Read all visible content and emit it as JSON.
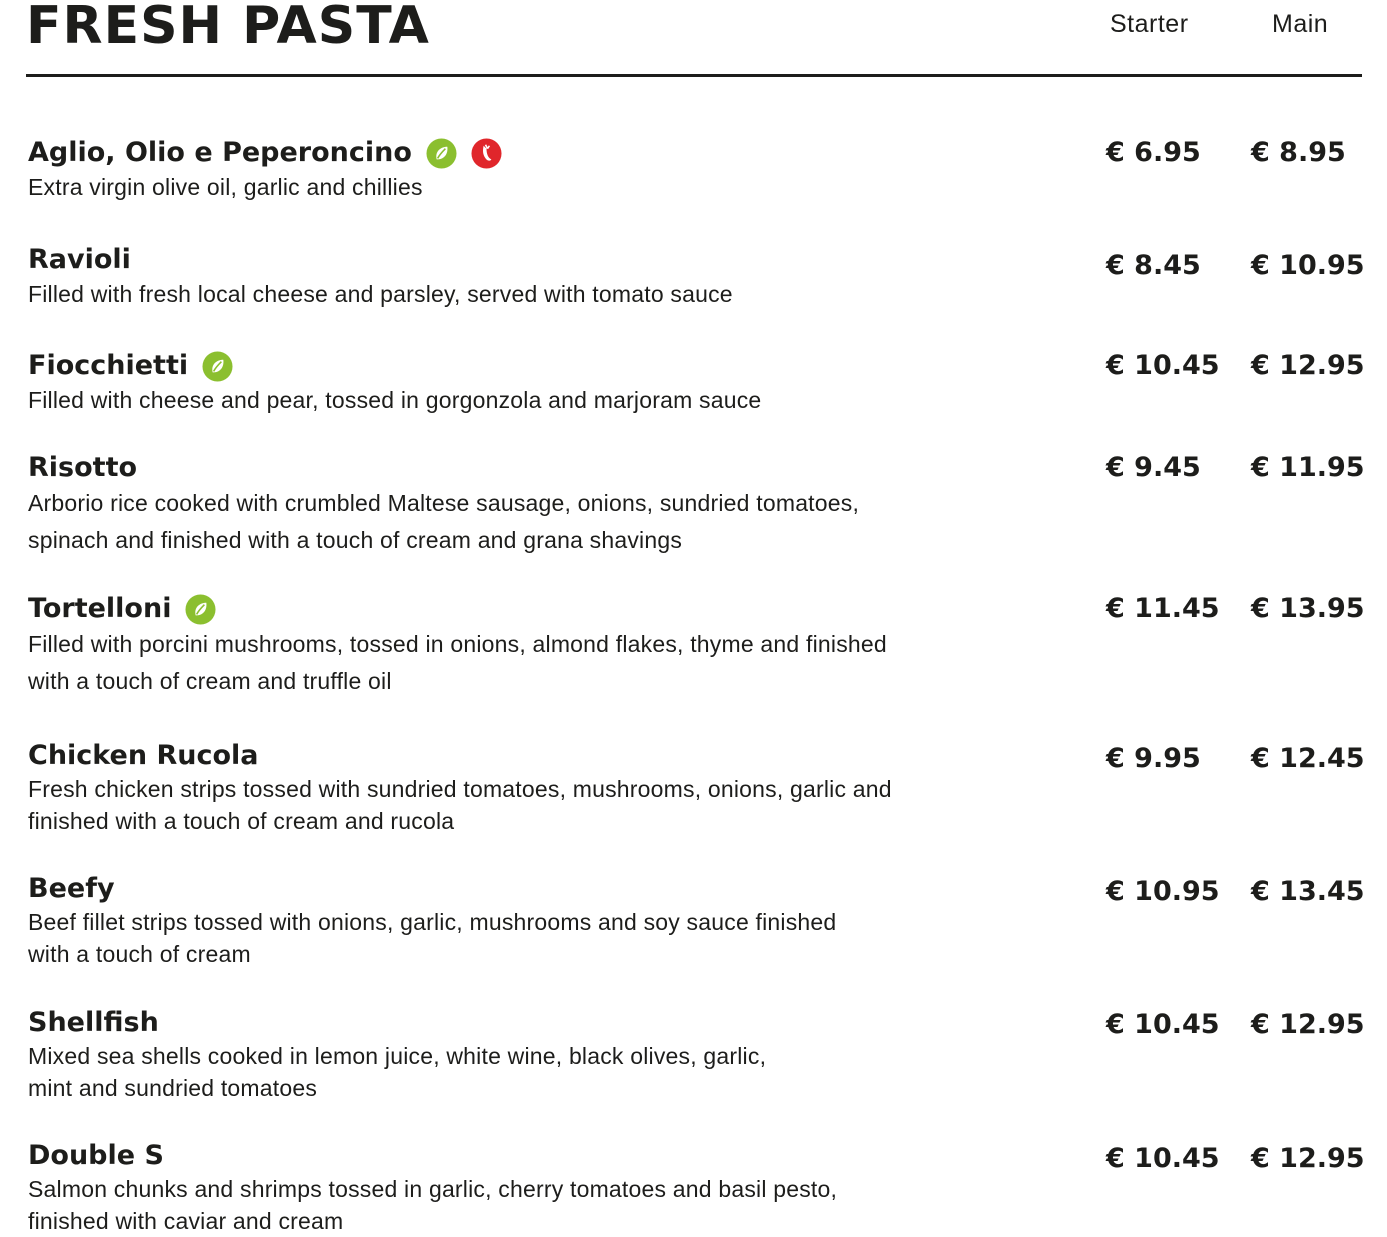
{
  "header": {
    "title": "FRESH PASTA",
    "col_starter": "Starter",
    "col_main": "Main"
  },
  "colors": {
    "vegetarian_icon": "#8bbf2f",
    "spicy_icon": "#e0262b",
    "text": "#1d1d1b"
  },
  "items": [
    {
      "name": "Aglio, Olio e Peperoncino",
      "icons": [
        "leaf-icon",
        "chilli-icon"
      ],
      "desc_lines": [
        "Extra virgin olive oil, garlic and chillies"
      ],
      "starter": "€ 6.95",
      "main": "€  8.95"
    },
    {
      "name": "Ravioli",
      "icons": [],
      "desc_lines": [
        "Filled with fresh local cheese and parsley, served with tomato sauce"
      ],
      "starter": "€ 8.45",
      "main": "€ 10.95"
    },
    {
      "name": "Fiocchietti",
      "icons": [
        "leaf-icon"
      ],
      "desc_lines": [
        "Filled with cheese and pear, tossed in gorgonzola and marjoram sauce"
      ],
      "starter": "€ 10.45",
      "main": "€ 12.95"
    },
    {
      "name": "Risotto",
      "icons": [],
      "desc_lines": [
        "Arborio rice cooked with crumbled Maltese sausage, onions, sundried tomatoes,",
        "spinach and finished with a touch of cream and grana shavings"
      ],
      "starter": "€ 9.45",
      "main": "€ 11.95"
    },
    {
      "name": "Tortelloni",
      "icons": [
        "leaf-icon"
      ],
      "desc_lines": [
        "Filled with porcini mushrooms, tossed in onions, almond flakes, thyme and finished",
        "with a touch of cream and truffle oil"
      ],
      "starter": "€ 11.45",
      "main": "€ 13.95"
    },
    {
      "name": "Chicken Rucola",
      "icons": [],
      "desc_lines": [
        "Fresh chicken strips tossed with sundried tomatoes, mushrooms, onions, garlic and",
        "finished with a touch of cream and rucola"
      ],
      "starter": "€ 9.95",
      "main": "€ 12.45"
    },
    {
      "name": "Beefy",
      "icons": [],
      "desc_lines": [
        "Beef fillet strips tossed with onions, garlic, mushrooms and soy sauce finished",
        "with a touch of cream"
      ],
      "starter": "€ 10.95",
      "main": "€ 13.45"
    },
    {
      "name": "Shellfish",
      "icons": [],
      "desc_lines": [
        "Mixed sea shells cooked in lemon juice, white wine, black olives, garlic,",
        "mint and sundried tomatoes"
      ],
      "starter": "€ 10.45",
      "main": "€ 12.95"
    },
    {
      "name": "Double S",
      "icons": [],
      "desc_lines": [
        "Salmon chunks and shrimps tossed in garlic, cherry tomatoes and basil pesto,",
        "finished with caviar and cream"
      ],
      "starter": "€ 10.45",
      "main": "€ 12.95"
    }
  ]
}
